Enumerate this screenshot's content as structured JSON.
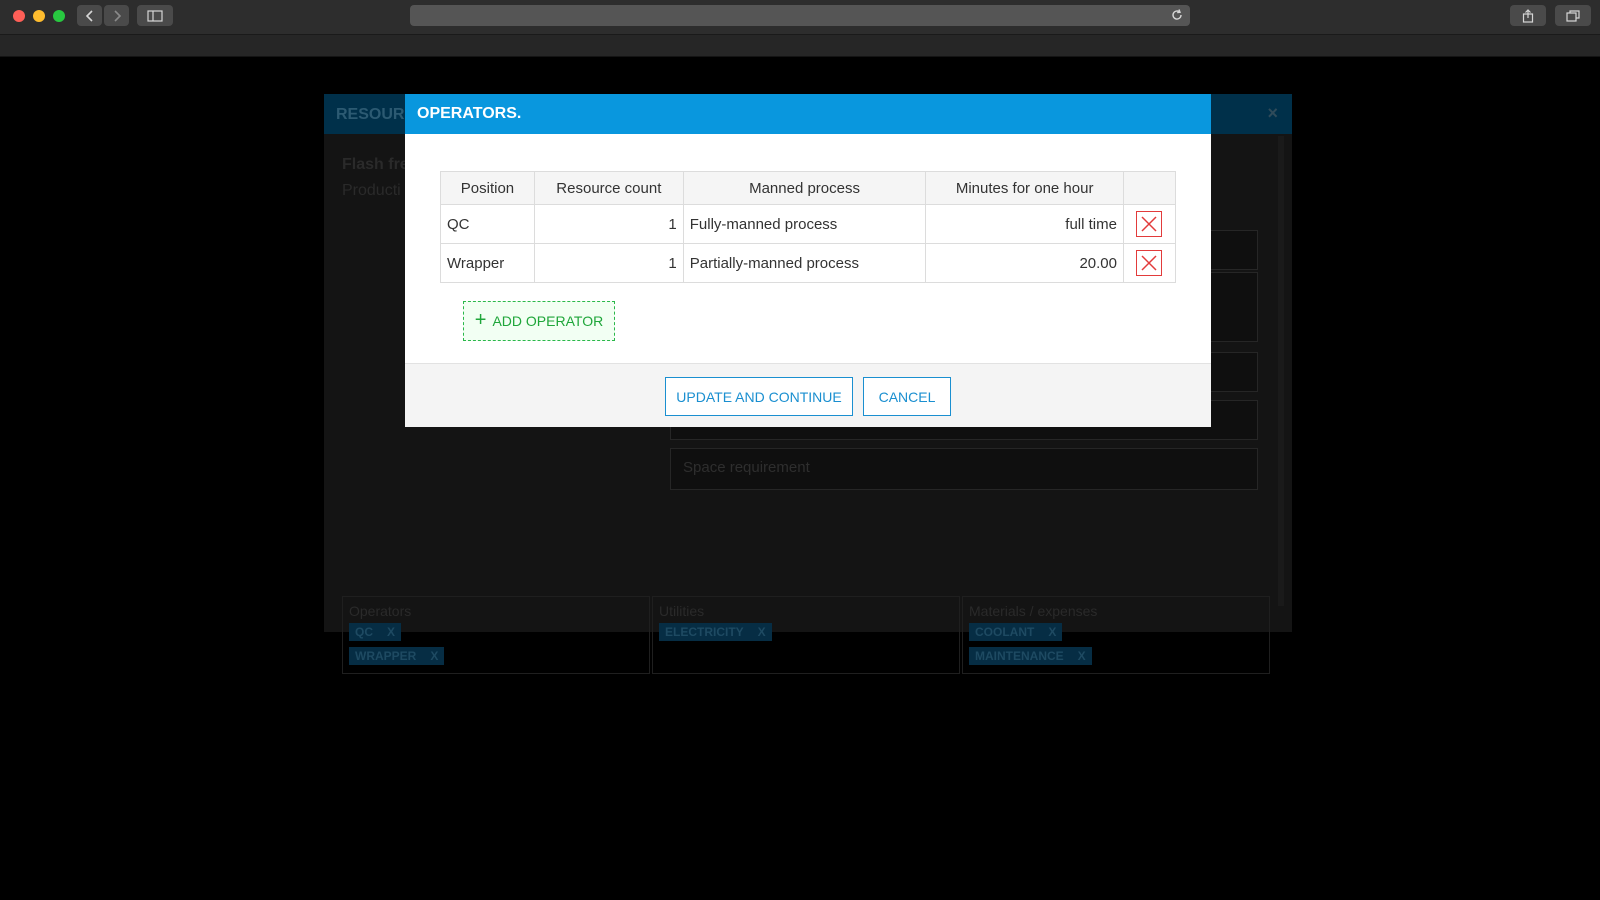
{
  "modal": {
    "title": "OPERATORS.",
    "columns": [
      "Position",
      "Resource count",
      "Manned process",
      "Minutes for one hour"
    ],
    "rows": [
      {
        "position": "QC",
        "count": "1",
        "process": "Fully-manned process",
        "minutes": "full time"
      },
      {
        "position": "Wrapper",
        "count": "1",
        "process": "Partially-manned process",
        "minutes": "20.00"
      }
    ],
    "add_label": "ADD OPERATOR",
    "update_label": "UPDATE AND CONTINUE",
    "cancel_label": "CANCEL"
  },
  "background": {
    "window_title": "RESOURC",
    "item_title": "Flash fre",
    "item_subtitle": "Producti",
    "space_requirement": "Space requirement",
    "operators_label": "Operators",
    "utilities_label": "Utilities",
    "materials_label": "Materials / expenses",
    "operator_chips": [
      "QC",
      "WRAPPER"
    ],
    "utility_chips": [
      "ELECTRICITY"
    ],
    "material_chips": [
      "COOLANT",
      "MAINTENANCE"
    ],
    "chip_remove": "X",
    "close_glyph": "×"
  },
  "colors": {
    "modal_header": "#0997de",
    "accent": "#1a8fd0",
    "add_green": "#1fa63a",
    "delete_red": "#e23b3b"
  },
  "icons": [
    "back-icon",
    "forward-icon",
    "sidebar-icon",
    "reload-icon",
    "share-icon",
    "tabs-icon",
    "close-icon",
    "delete-icon",
    "plus-icon"
  ]
}
